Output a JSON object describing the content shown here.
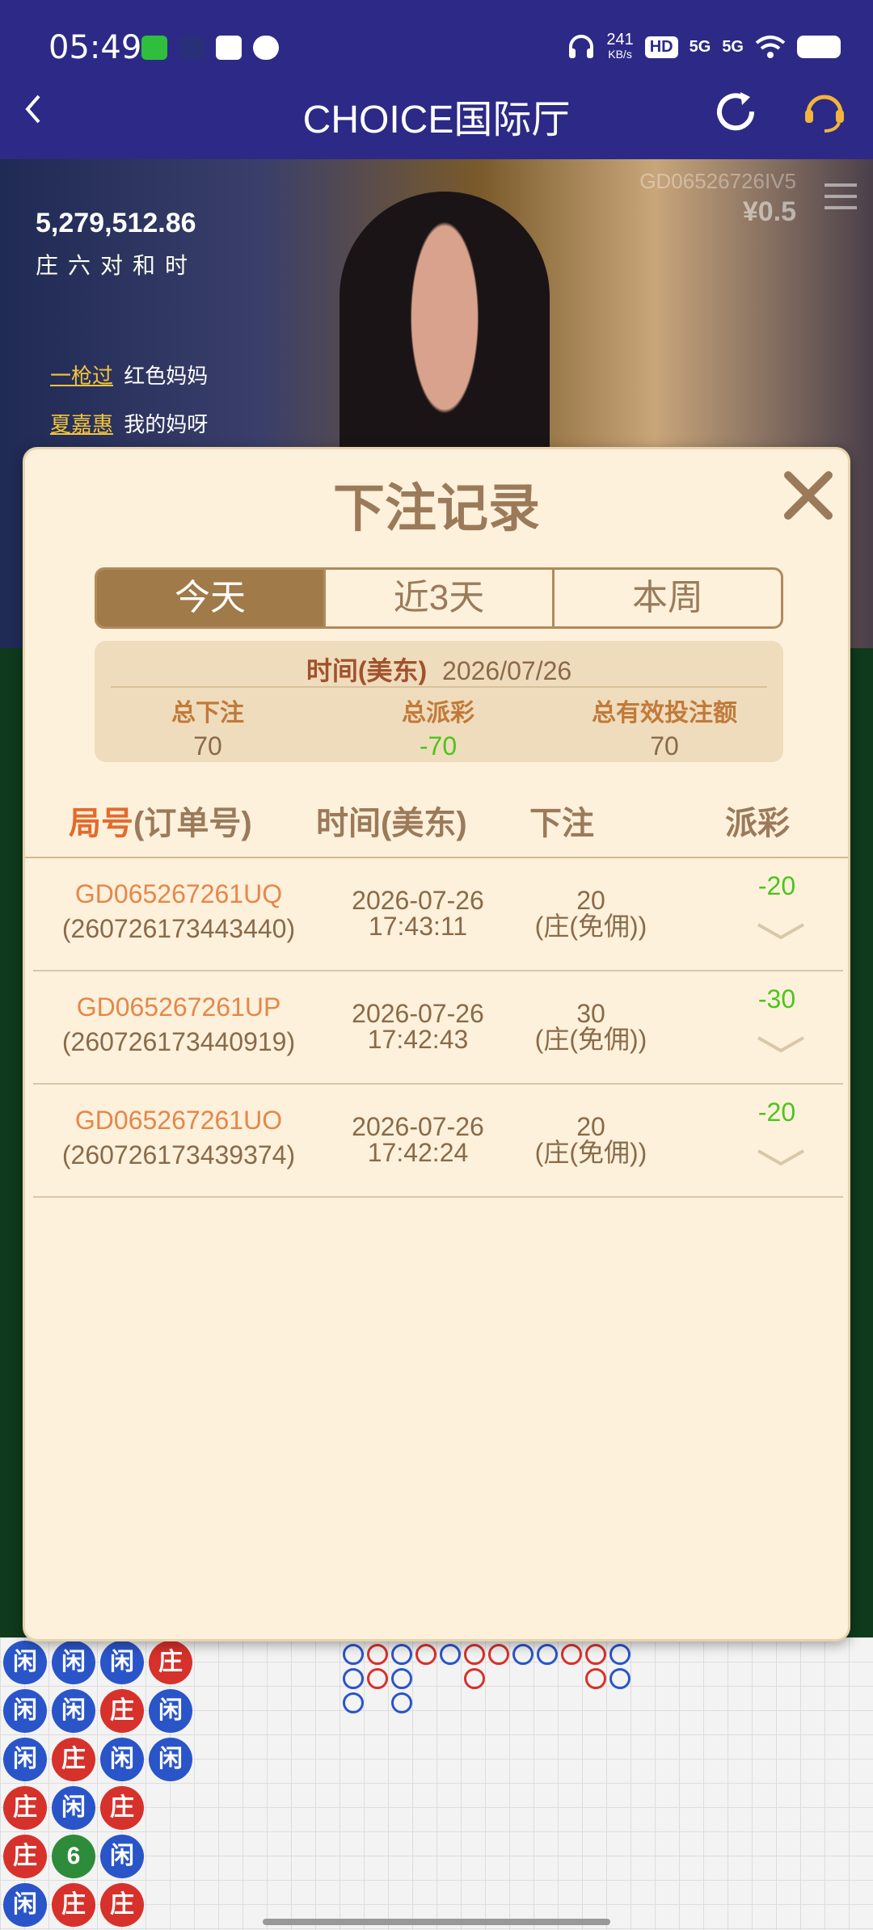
{
  "status_bar": {
    "time": "05:49",
    "speed": "241",
    "speed_unit": "KB/s",
    "net1": "5G",
    "net2": "5G",
    "hd": "HD"
  },
  "header": {
    "title": "CHOICE国际厅"
  },
  "video": {
    "score": "5,279,512.86",
    "road_names": "庄六对和时",
    "game_id": "GD06526726IV5",
    "amount": "¥0.5",
    "chat": [
      {
        "user": "一枪过",
        "msg": "红色妈妈"
      },
      {
        "user": "夏嘉惠",
        "msg": "我的妈呀"
      }
    ]
  },
  "modal": {
    "title": "下注记录",
    "tabs": [
      "今天",
      "近3天",
      "本周"
    ],
    "active_tab": 0,
    "summary": {
      "date_label": "时间(美东)",
      "date_value": "2026/07/26",
      "total_bet_label": "总下注",
      "total_bet": "70",
      "total_payout_label": "总派彩",
      "total_payout": "-70",
      "total_valid_label": "总有效投注额",
      "total_valid": "70"
    },
    "columns": {
      "round_accent": "局号",
      "round_rest": "(订单号)",
      "time": "时间(美东)",
      "bet": "下注",
      "payout": "派彩"
    },
    "rows": [
      {
        "round": "GD065267261UQ",
        "order": "(260726173443440)",
        "date": "2026-07-26",
        "time": "17:43:11",
        "bet": "20",
        "bet_type": "(庄(免佣))",
        "payout": "-20"
      },
      {
        "round": "GD065267261UP",
        "order": "(260726173440919)",
        "date": "2026-07-26",
        "time": "17:42:43",
        "bet": "30",
        "bet_type": "(庄(免佣))",
        "payout": "-30"
      },
      {
        "round": "GD065267261UO",
        "order": "(260726173439374)",
        "date": "2026-07-26",
        "time": "17:42:24",
        "bet": "20",
        "bet_type": "(庄(免佣))",
        "payout": "-20"
      }
    ]
  },
  "bead_road": [
    [
      "闲",
      "闲",
      "闲",
      "庄"
    ],
    [
      "闲",
      "闲",
      "庄",
      "闲"
    ],
    [
      "闲",
      "庄",
      "闲",
      "闲"
    ],
    [
      "庄",
      "闲",
      "庄",
      ""
    ],
    [
      "庄",
      "6",
      "闲",
      ""
    ],
    [
      "闲",
      "庄",
      "庄",
      ""
    ]
  ],
  "colors": {
    "accent": "#a07a48",
    "positive": "#4cc51c",
    "link": "#e5874a",
    "header_bg": "#2c2a86"
  }
}
